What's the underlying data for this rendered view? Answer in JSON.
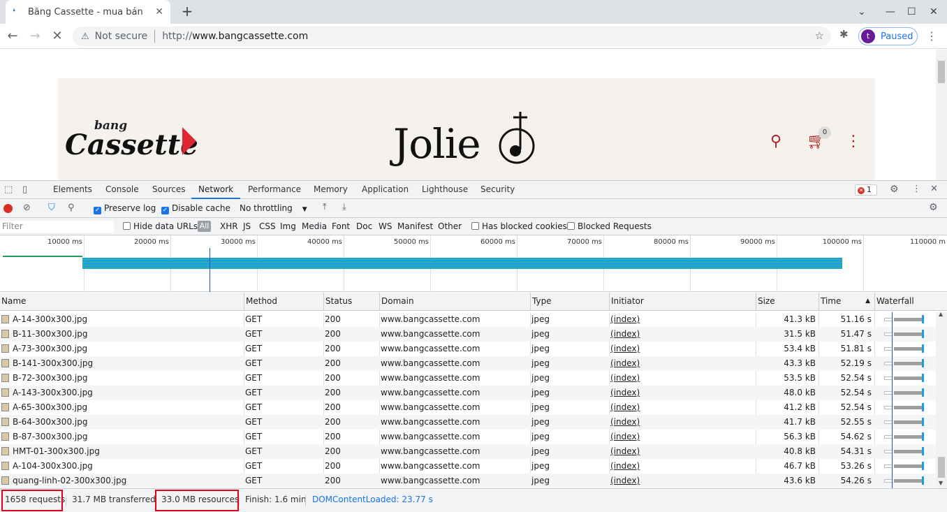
{
  "browser": {
    "tab_title": "Băng Cassette - mua bán",
    "tab_close": "✕",
    "new_tab": "+",
    "security_label": "Not secure",
    "url_scheme": "http://",
    "url_host": "www.bangcassette.com",
    "profile_initial": "t",
    "profile_status": "Paused"
  },
  "site": {
    "logo_small": "bang",
    "logo_big": "Cassette",
    "brand": "Jolie",
    "cart_count": "0"
  },
  "devtools": {
    "tabs": [
      "Elements",
      "Console",
      "Sources",
      "Network",
      "Performance",
      "Memory",
      "Application",
      "Lighthouse",
      "Security"
    ],
    "active_tab": "Network",
    "error_count": "1",
    "preserve_log": "Preserve log",
    "disable_cache": "Disable cache",
    "throttling": "No throttling",
    "filter_placeholder": "Filter",
    "hide_data_urls": "Hide data URLs",
    "type_filters": [
      "All",
      "XHR",
      "JS",
      "CSS",
      "Img",
      "Media",
      "Font",
      "Doc",
      "WS",
      "Manifest",
      "Other"
    ],
    "has_blocked_cookies": "Has blocked cookies",
    "blocked_requests": "Blocked Requests",
    "timeline_ticks": [
      "10000 ms",
      "20000 ms",
      "30000 ms",
      "40000 ms",
      "50000 ms",
      "60000 ms",
      "70000 ms",
      "80000 ms",
      "90000 ms",
      "100000 ms",
      "110000 m"
    ],
    "columns": [
      "Name",
      "Method",
      "Status",
      "Domain",
      "Type",
      "Initiator",
      "Size",
      "Time",
      "Waterfall"
    ],
    "rows": [
      {
        "name": "A-14-300x300.jpg",
        "method": "GET",
        "status": "200",
        "domain": "www.bangcassette.com",
        "type": "jpeg",
        "initiator": "(index)",
        "size": "41.3 kB",
        "time": "51.16 s"
      },
      {
        "name": "B-11-300x300.jpg",
        "method": "GET",
        "status": "200",
        "domain": "www.bangcassette.com",
        "type": "jpeg",
        "initiator": "(index)",
        "size": "31.5 kB",
        "time": "51.47 s"
      },
      {
        "name": "A-73-300x300.jpg",
        "method": "GET",
        "status": "200",
        "domain": "www.bangcassette.com",
        "type": "jpeg",
        "initiator": "(index)",
        "size": "53.4 kB",
        "time": "51.81 s"
      },
      {
        "name": "B-141-300x300.jpg",
        "method": "GET",
        "status": "200",
        "domain": "www.bangcassette.com",
        "type": "jpeg",
        "initiator": "(index)",
        "size": "43.3 kB",
        "time": "52.19 s"
      },
      {
        "name": "B-72-300x300.jpg",
        "method": "GET",
        "status": "200",
        "domain": "www.bangcassette.com",
        "type": "jpeg",
        "initiator": "(index)",
        "size": "53.5 kB",
        "time": "52.54 s"
      },
      {
        "name": "A-143-300x300.jpg",
        "method": "GET",
        "status": "200",
        "domain": "www.bangcassette.com",
        "type": "jpeg",
        "initiator": "(index)",
        "size": "48.0 kB",
        "time": "52.54 s"
      },
      {
        "name": "A-65-300x300.jpg",
        "method": "GET",
        "status": "200",
        "domain": "www.bangcassette.com",
        "type": "jpeg",
        "initiator": "(index)",
        "size": "41.2 kB",
        "time": "52.54 s"
      },
      {
        "name": "B-64-300x300.jpg",
        "method": "GET",
        "status": "200",
        "domain": "www.bangcassette.com",
        "type": "jpeg",
        "initiator": "(index)",
        "size": "41.7 kB",
        "time": "52.55 s"
      },
      {
        "name": "B-87-300x300.jpg",
        "method": "GET",
        "status": "200",
        "domain": "www.bangcassette.com",
        "type": "jpeg",
        "initiator": "(index)",
        "size": "56.3 kB",
        "time": "54.62 s"
      },
      {
        "name": "HMT-01-300x300.jpg",
        "method": "GET",
        "status": "200",
        "domain": "www.bangcassette.com",
        "type": "jpeg",
        "initiator": "(index)",
        "size": "40.8 kB",
        "time": "54.31 s"
      },
      {
        "name": "A-104-300x300.jpg",
        "method": "GET",
        "status": "200",
        "domain": "www.bangcassette.com",
        "type": "jpeg",
        "initiator": "(index)",
        "size": "46.7 kB",
        "time": "53.26 s"
      },
      {
        "name": "quang-linh-02-300x300.jpg",
        "method": "GET",
        "status": "200",
        "domain": "www.bangcassette.com",
        "type": "jpeg",
        "initiator": "(index)",
        "size": "43.6 kB",
        "time": "54.26 s"
      }
    ],
    "summary": {
      "requests": "1658 requests",
      "transferred": "31.7 MB transferred",
      "resources": "33.0 MB resources",
      "finish": "Finish: 1.6 min",
      "dcl": "DOMContentLoaded: 23.77 s"
    }
  },
  "colors": {
    "accent": "#1a73e8",
    "highlight_box": "#e3001b",
    "cassette_red": "#e02633",
    "dcl_blue": "#1a73e8"
  }
}
